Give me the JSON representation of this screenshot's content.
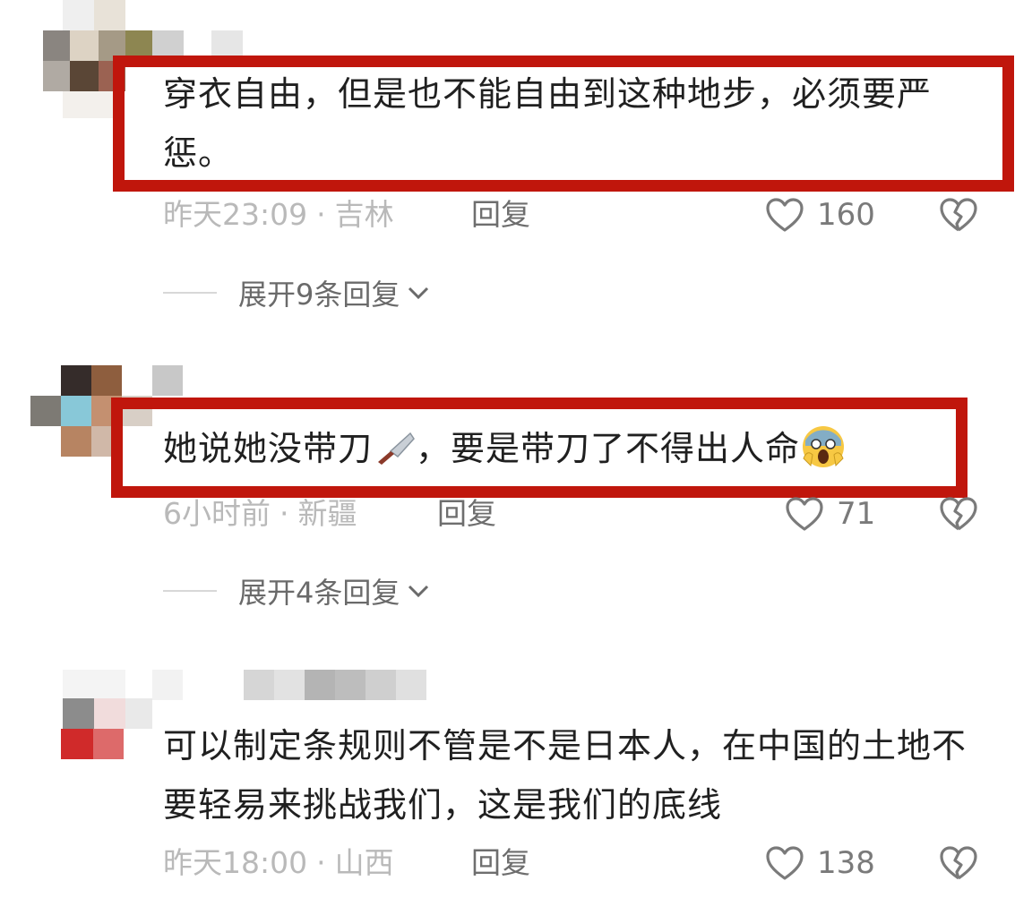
{
  "comments": [
    {
      "text": "穿衣自由，但是也不能自由到这种地步，必须要严惩。",
      "time": "昨天23:09",
      "location": "吉林",
      "reply_label": "回复",
      "likes": "160",
      "expand_label": "展开9条回复"
    },
    {
      "text_part1": "她说她没带刀",
      "text_part2": "，要是带刀了不得出人命",
      "time": "6小时前",
      "location": "新疆",
      "reply_label": "回复",
      "likes": "71",
      "expand_label": "展开4条回复"
    },
    {
      "text": "可以制定条规则不管是不是日本人，在中国的土地不要轻易来挑战我们，这是我们的底线",
      "time": "昨天18:00",
      "location": "山西",
      "reply_label": "回复",
      "likes": "138"
    }
  ],
  "separator": "·",
  "icons": {
    "like": "heart-outline-icon",
    "dislike": "broken-heart-icon",
    "expand": "chevron-down-icon",
    "knife": "kitchen-knife-emoji",
    "scream": "face-screaming-emoji"
  },
  "colors": {
    "highlight_border": "#c0160c",
    "meta_text": "#b9b9b9",
    "reply_text": "#6e6e6e"
  }
}
